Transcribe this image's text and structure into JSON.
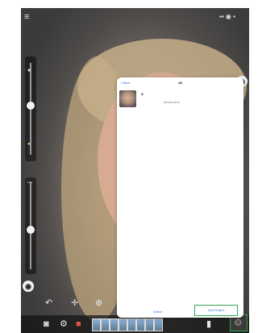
{
  "panel": {
    "back_label": "< Back",
    "title": "All",
    "item": {
      "name": "A",
      "time": "00:00:01 00:21"
    },
    "cancel_label": "Select",
    "add_label": "Add Project"
  },
  "colors": {
    "accent_blue": "#2a7ae2",
    "highlight_green": "#2ea84c",
    "panel_bg": "#ffffff"
  }
}
